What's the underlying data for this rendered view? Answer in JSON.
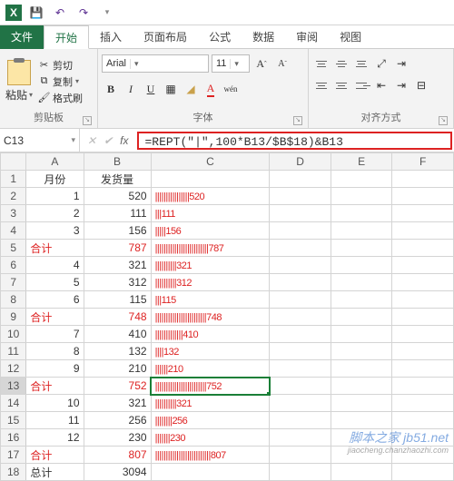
{
  "qat": {
    "excel_icon": "X",
    "save": "💾",
    "undo": "↶",
    "redo": "↷"
  },
  "tabs": {
    "file": "文件",
    "home": "开始",
    "insert": "插入",
    "layout": "页面布局",
    "formulas": "公式",
    "data": "数据",
    "review": "审阅",
    "view": "视图"
  },
  "ribbon": {
    "clipboard": {
      "paste": "粘贴",
      "cut": "剪切",
      "copy": "复制",
      "format_painter": "格式刷",
      "group": "剪贴板"
    },
    "font": {
      "name": "Arial",
      "size": "11",
      "group": "字体"
    },
    "align": {
      "group": "对齐方式"
    }
  },
  "namebox": "C13",
  "formula": "=REPT(\"|\",100*B13/$B$18)&B13",
  "columns": [
    "A",
    "B",
    "C",
    "D",
    "E",
    "F"
  ],
  "chart_data": {
    "type": "bar",
    "title": "",
    "xlabel": "月份",
    "ylabel": "发货量",
    "categories": [
      "1",
      "2",
      "3",
      "合计",
      "4",
      "5",
      "6",
      "合计",
      "7",
      "8",
      "9",
      "合计",
      "10",
      "11",
      "12",
      "合计",
      "总计"
    ],
    "values": [
      520,
      111,
      156,
      787,
      321,
      312,
      115,
      748,
      410,
      132,
      210,
      752,
      321,
      256,
      230,
      807,
      3094
    ],
    "formula": "=REPT(\"|\",100*B13/$B$18)&B13"
  },
  "headers": {
    "a": "月份",
    "b": "发货量"
  },
  "rows": [
    {
      "n": "1",
      "a": "月份",
      "b": "发货量",
      "c": "",
      "sum": false,
      "hdr": true
    },
    {
      "n": "2",
      "a": "1",
      "b": "520",
      "c": "||||||||||||||||520",
      "sum": false
    },
    {
      "n": "3",
      "a": "2",
      "b": "111",
      "c": "|||111",
      "sum": false
    },
    {
      "n": "4",
      "a": "3",
      "b": "156",
      "c": "|||||156",
      "sum": false
    },
    {
      "n": "5",
      "a": "合计",
      "b": "787",
      "c": "|||||||||||||||||||||||||787",
      "sum": true
    },
    {
      "n": "6",
      "a": "4",
      "b": "321",
      "c": "||||||||||321",
      "sum": false
    },
    {
      "n": "7",
      "a": "5",
      "b": "312",
      "c": "||||||||||312",
      "sum": false
    },
    {
      "n": "8",
      "a": "6",
      "b": "115",
      "c": "|||115",
      "sum": false
    },
    {
      "n": "9",
      "a": "合计",
      "b": "748",
      "c": "||||||||||||||||||||||||748",
      "sum": true
    },
    {
      "n": "10",
      "a": "7",
      "b": "410",
      "c": "|||||||||||||410",
      "sum": false
    },
    {
      "n": "11",
      "a": "8",
      "b": "132",
      "c": "||||132",
      "sum": false
    },
    {
      "n": "12",
      "a": "9",
      "b": "210",
      "c": "||||||210",
      "sum": false
    },
    {
      "n": "13",
      "a": "合计",
      "b": "752",
      "c": "||||||||||||||||||||||||752",
      "sum": true,
      "sel": true
    },
    {
      "n": "14",
      "a": "10",
      "b": "321",
      "c": "||||||||||321",
      "sum": false
    },
    {
      "n": "15",
      "a": "11",
      "b": "256",
      "c": "||||||||256",
      "sum": false
    },
    {
      "n": "16",
      "a": "12",
      "b": "230",
      "c": "|||||||230",
      "sum": false
    },
    {
      "n": "17",
      "a": "合计",
      "b": "807",
      "c": "||||||||||||||||||||||||||807",
      "sum": true
    },
    {
      "n": "18",
      "a": "总计",
      "b": "3094",
      "c": "",
      "sum": false
    }
  ],
  "watermark": {
    "main": "脚本之家 jb51.net",
    "sub": "jiaocheng.chanzhaozhi.com"
  }
}
